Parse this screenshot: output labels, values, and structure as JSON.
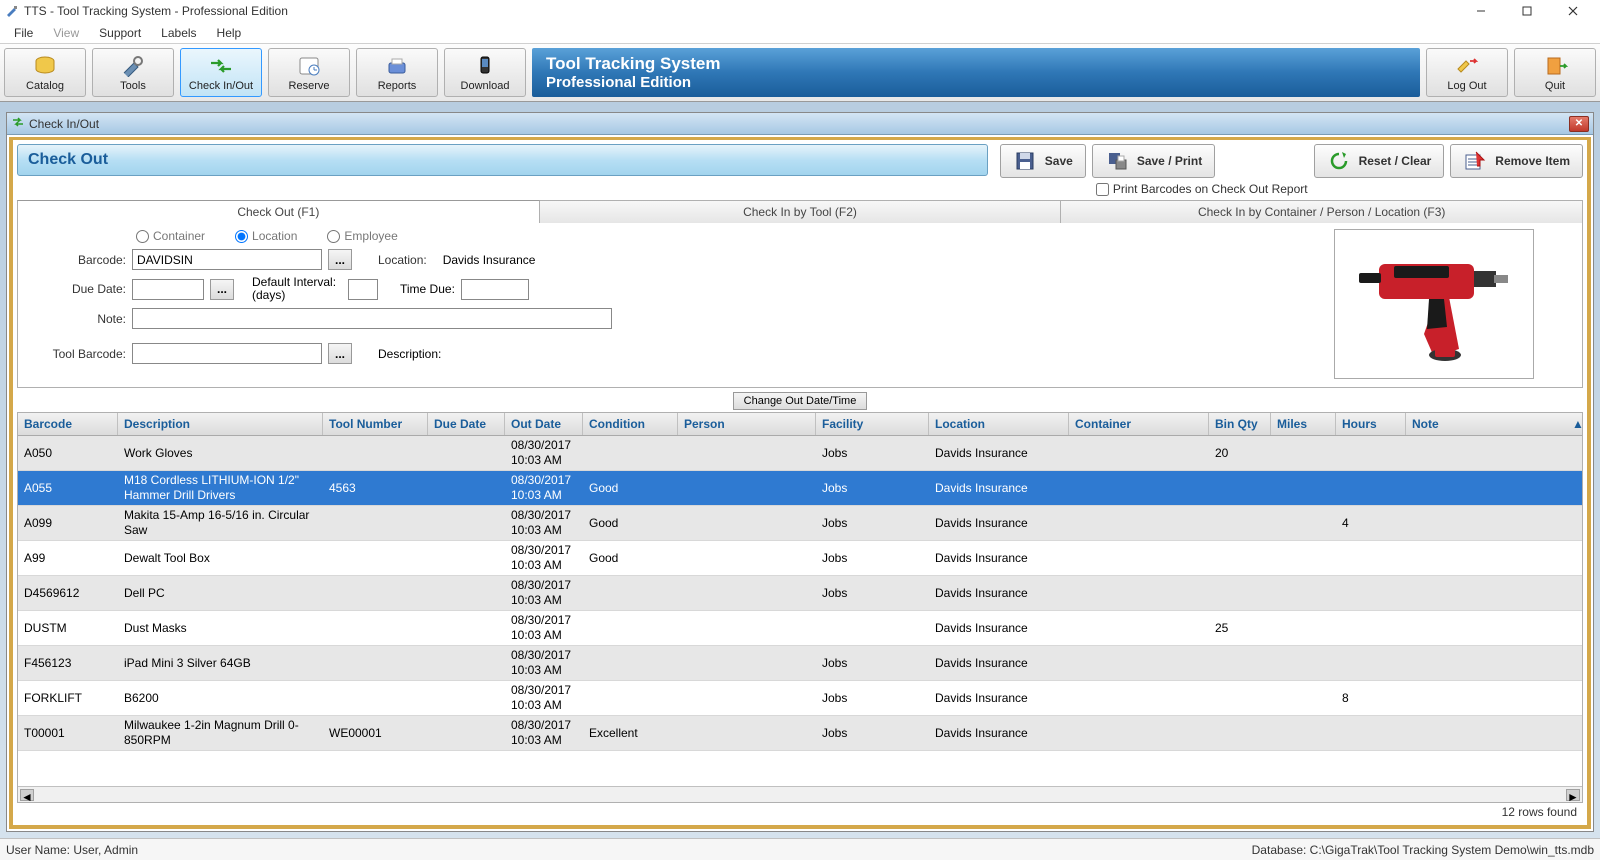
{
  "title": "TTS - Tool Tracking System - Professional Edition",
  "menu": [
    "File",
    "View",
    "Support",
    "Labels",
    "Help"
  ],
  "toolbar": {
    "buttons": [
      "Catalog",
      "Tools",
      "Check In/Out",
      "Reserve",
      "Reports",
      "Download"
    ],
    "active_index": 2,
    "title1": "Tool Tracking System",
    "title2": "Professional Edition",
    "right_buttons": [
      "Log Out",
      "Quit"
    ]
  },
  "panel": {
    "title": "Check In/Out",
    "banner": "Check Out",
    "actions": [
      "Save",
      "Save / Print",
      "Reset / Clear",
      "Remove Item"
    ],
    "print_barcode_label": "Print Barcodes on Check Out Report",
    "print_barcode_checked": false,
    "tabs": [
      "Check Out (F1)",
      "Check In by Tool (F2)",
      "Check In by Container / Person / Location (F3)"
    ],
    "active_tab": 0
  },
  "form": {
    "radios": [
      "Container",
      "Location",
      "Employee"
    ],
    "radio_selected": 1,
    "labels": {
      "barcode": "Barcode:",
      "location": "Location:",
      "due_date": "Due Date:",
      "default_interval": "Default Interval: (days)",
      "time_due": "Time Due:",
      "note": "Note:",
      "tool_barcode": "Tool Barcode:",
      "description": "Description:"
    },
    "values": {
      "barcode": "DAVIDSIN",
      "location": "Davids Insurance",
      "due_date": "",
      "default_interval": "",
      "time_due": "",
      "note": "",
      "tool_barcode": "",
      "description": ""
    },
    "change_btn": "Change Out Date/Time"
  },
  "grid": {
    "columns": [
      "Barcode",
      "Description",
      "Tool Number",
      "Due Date",
      "Out Date",
      "Condition",
      "Person",
      "Facility",
      "Location",
      "Container",
      "Bin Qty",
      "Miles",
      "Hours",
      "Note"
    ],
    "selected_index": 1,
    "rows": [
      {
        "barcode": "A050",
        "desc": "Work Gloves",
        "tool": "",
        "due": "",
        "out": "08/30/2017 10:03 AM",
        "cond": "",
        "person": "",
        "fac": "Jobs",
        "loc": "Davids Insurance",
        "cont": "",
        "bin": "20",
        "miles": "",
        "hours": "",
        "note": ""
      },
      {
        "barcode": "A055",
        "desc": "M18 Cordless LITHIUM-ION 1/2\" Hammer Drill Drivers",
        "tool": "4563",
        "due": "",
        "out": "08/30/2017 10:03 AM",
        "cond": "Good",
        "person": "",
        "fac": "Jobs",
        "loc": "Davids Insurance",
        "cont": "",
        "bin": "",
        "miles": "",
        "hours": "",
        "note": ""
      },
      {
        "barcode": "A099",
        "desc": "Makita 15-Amp 16-5/16 in. Circular Saw",
        "tool": "",
        "due": "",
        "out": "08/30/2017 10:03 AM",
        "cond": "Good",
        "person": "",
        "fac": "Jobs",
        "loc": "Davids Insurance",
        "cont": "",
        "bin": "",
        "miles": "",
        "hours": "4",
        "note": ""
      },
      {
        "barcode": "A99",
        "desc": "Dewalt Tool Box",
        "tool": "",
        "due": "",
        "out": "08/30/2017 10:03 AM",
        "cond": "Good",
        "person": "",
        "fac": "Jobs",
        "loc": "Davids Insurance",
        "cont": "",
        "bin": "",
        "miles": "",
        "hours": "",
        "note": ""
      },
      {
        "barcode": "D4569612",
        "desc": "Dell PC",
        "tool": "",
        "due": "",
        "out": "08/30/2017 10:03 AM",
        "cond": "",
        "person": "",
        "fac": "Jobs",
        "loc": "Davids Insurance",
        "cont": "",
        "bin": "",
        "miles": "",
        "hours": "",
        "note": ""
      },
      {
        "barcode": "DUSTM",
        "desc": "Dust Masks",
        "tool": "",
        "due": "",
        "out": "08/30/2017 10:03 AM",
        "cond": "",
        "person": "",
        "fac": "",
        "loc": "Davids Insurance",
        "cont": "",
        "bin": "25",
        "miles": "",
        "hours": "",
        "note": ""
      },
      {
        "barcode": "F456123",
        "desc": "iPad Mini 3 Silver 64GB",
        "tool": "",
        "due": "",
        "out": "08/30/2017 10:03 AM",
        "cond": "",
        "person": "",
        "fac": "Jobs",
        "loc": "Davids Insurance",
        "cont": "",
        "bin": "",
        "miles": "",
        "hours": "",
        "note": ""
      },
      {
        "barcode": "FORKLIFT",
        "desc": "B6200",
        "tool": "",
        "due": "",
        "out": "08/30/2017 10:03 AM",
        "cond": "",
        "person": "",
        "fac": "Jobs",
        "loc": "Davids Insurance",
        "cont": "",
        "bin": "",
        "miles": "",
        "hours": "8",
        "note": ""
      },
      {
        "barcode": "T00001",
        "desc": "Milwaukee 1-2in Magnum Drill 0-850RPM",
        "tool": "WE00001",
        "due": "",
        "out": "08/30/2017 10:03 AM",
        "cond": "Excellent",
        "person": "",
        "fac": "Jobs",
        "loc": "Davids Insurance",
        "cont": "",
        "bin": "",
        "miles": "",
        "hours": "",
        "note": ""
      }
    ],
    "footer": "12 rows found"
  },
  "status": {
    "user": "User Name:  User, Admin",
    "db": "Database:  C:\\GigaTrak\\Tool Tracking System Demo\\win_tts.mdb"
  }
}
